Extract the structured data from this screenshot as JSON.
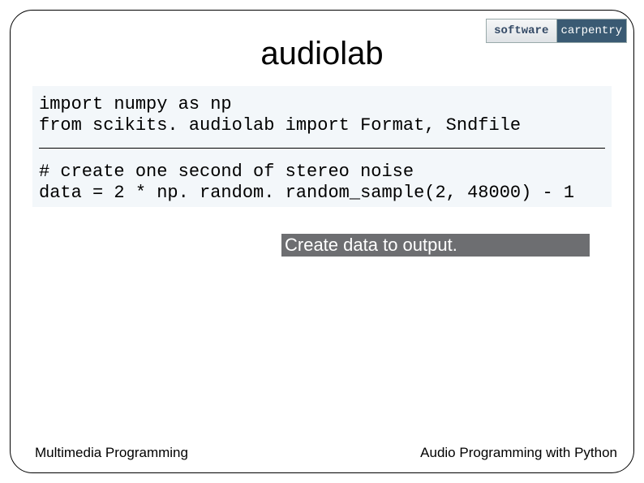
{
  "logo": {
    "left": "software",
    "right": "carpentry"
  },
  "title": "audiolab",
  "code": {
    "line1": "import numpy as np",
    "line2": "from scikits. audiolab import Format, Sndfile",
    "line3": "# create one second of stereo noise",
    "line4": "data = 2 * np. random. random_sample(2, 48000) - 1"
  },
  "callout": "Create data to output.",
  "footer": {
    "left": "Multimedia Programming",
    "right": "Audio Programming with Python"
  }
}
